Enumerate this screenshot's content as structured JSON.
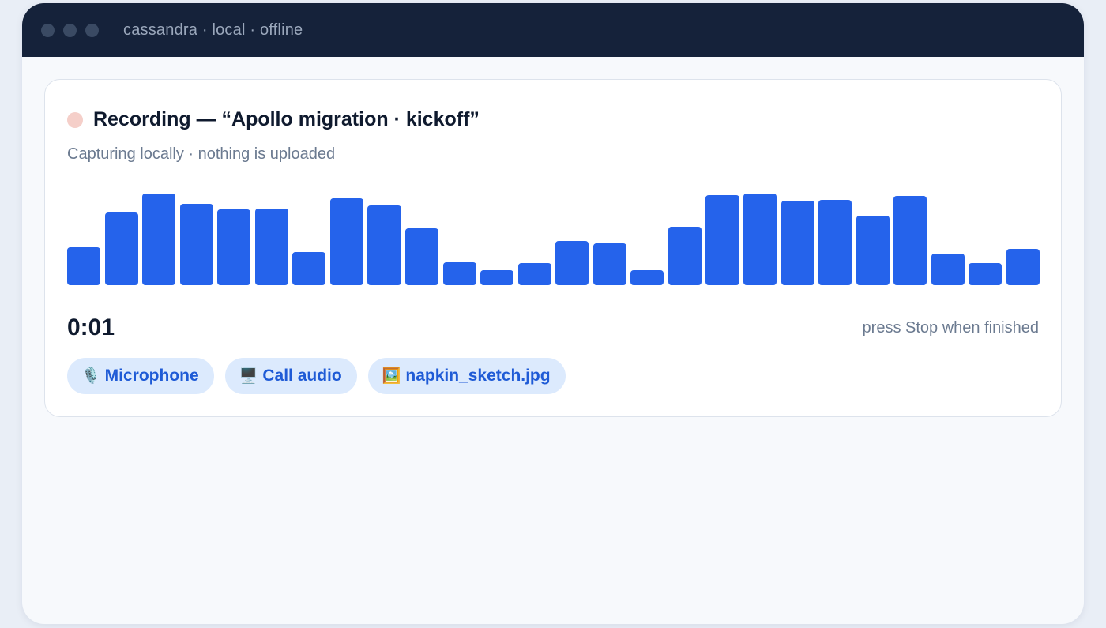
{
  "window": {
    "title": "cassandra · local · offline"
  },
  "recording": {
    "title": "Recording — “Apollo migration · kickoff”",
    "subtitle": "Capturing locally · nothing is uploaded",
    "timer": "0:01",
    "hint": "press Stop when finished",
    "levels": [
      0.4,
      0.77,
      0.97,
      0.86,
      0.8,
      0.81,
      0.35,
      0.92,
      0.84,
      0.6,
      0.24,
      0.16,
      0.23,
      0.47,
      0.44,
      0.16,
      0.62,
      0.95,
      0.97,
      0.89,
      0.9,
      0.73,
      0.94,
      0.33,
      0.23,
      0.38
    ]
  },
  "sources": [
    {
      "icon": "microphone-icon",
      "glyph": "🎙️",
      "label": "Microphone"
    },
    {
      "icon": "desktop-icon",
      "glyph": "🖥️",
      "label": "Call audio"
    },
    {
      "icon": "picture-icon",
      "glyph": "🖼️",
      "label": "napkin_sketch.jpg"
    }
  ],
  "colors": {
    "accent": "#2563eb",
    "titlebar": "#15223a",
    "recording_dot": "#f5cfc9",
    "chip_bg": "#dceafd"
  }
}
